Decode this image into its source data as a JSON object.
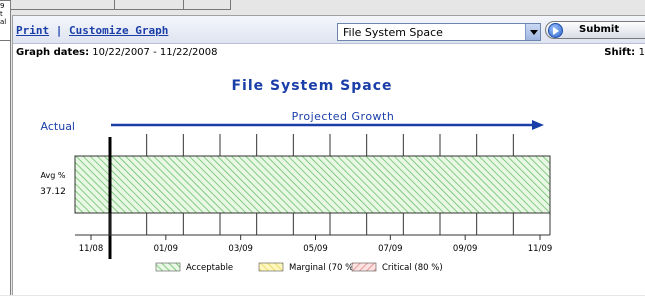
{
  "toolbar": {
    "print_label": "Print",
    "separator": "|",
    "customize_label": "Customize Graph",
    "select_value": "File System Space",
    "submit_label": "Submit"
  },
  "header": {
    "dates_label": "Graph dates:",
    "dates_value": "10/22/2007 - 11/22/2008",
    "shift_label": "Shift:",
    "shift_value": "1"
  },
  "left_fragments": [
    "9",
    "t",
    "al"
  ],
  "colors": {
    "title_blue": "#1a3ea8",
    "acceptable": "#2e9a2e",
    "marginal": "#f3e36b",
    "critical": "#d45555"
  },
  "chart_data": {
    "type": "area",
    "title": "File System Space",
    "actual_label": "Actual",
    "projected_label": "Projected Growth",
    "ylabel": "Avg %",
    "value": 37.12,
    "value_label": "37.12",
    "categories": [
      "11/08",
      "01/09",
      "03/09",
      "05/09",
      "07/09",
      "09/09",
      "11/09"
    ],
    "series": [
      {
        "name": "Acceptable",
        "band": "acceptable"
      },
      {
        "name": "Marginal (70 %)",
        "band": "marginal"
      },
      {
        "name": "Critical (80 %)",
        "band": "critical"
      }
    ]
  }
}
